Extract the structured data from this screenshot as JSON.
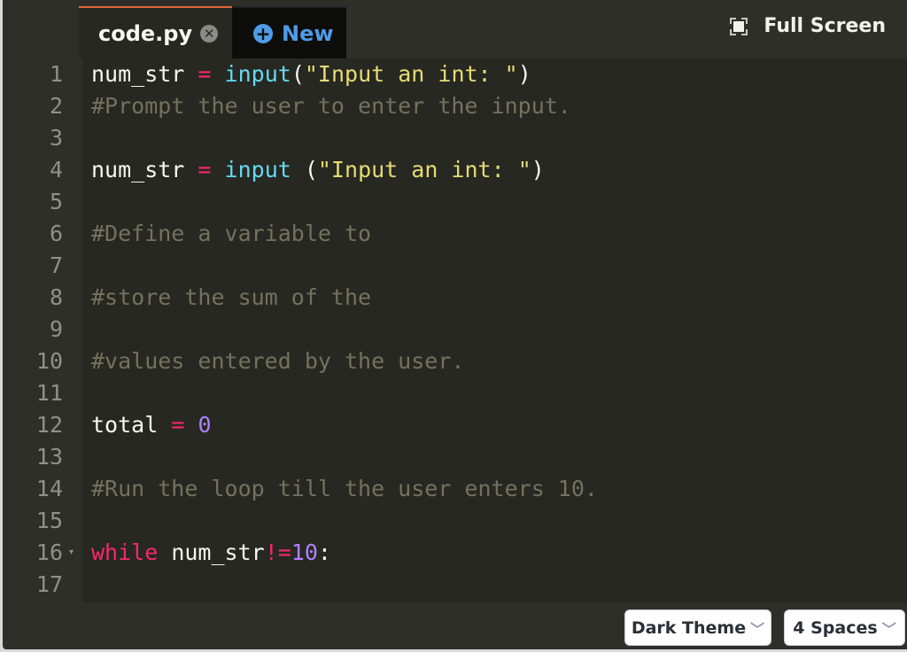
{
  "tabs": [
    {
      "label": "code.py",
      "close_icon": "close-icon",
      "active": true
    },
    {
      "label": "New",
      "icon": "plus-circle-icon",
      "active": false
    }
  ],
  "header": {
    "fullscreen_label": "Full Screen",
    "fullscreen_icon": "fullscreen-icon"
  },
  "editor": {
    "lines": [
      {
        "n": "1",
        "tokens": [
          [
            "",
            "num_str "
          ],
          [
            "op",
            "="
          ],
          [
            "",
            " "
          ],
          [
            "fn",
            "input"
          ],
          [
            "",
            "("
          ],
          [
            "str",
            "\"Input an int: \""
          ],
          [
            "",
            ")"
          ]
        ]
      },
      {
        "n": "2",
        "tokens": [
          [
            "cm",
            "#Prompt the user to enter the input."
          ]
        ]
      },
      {
        "n": "3",
        "tokens": []
      },
      {
        "n": "4",
        "tokens": [
          [
            "",
            "num_str "
          ],
          [
            "op",
            "="
          ],
          [
            "",
            " "
          ],
          [
            "fn",
            "input"
          ],
          [
            "",
            " ("
          ],
          [
            "str",
            "\"Input an int: \""
          ],
          [
            "",
            ")"
          ]
        ]
      },
      {
        "n": "5",
        "tokens": []
      },
      {
        "n": "6",
        "tokens": [
          [
            "cm",
            "#Define a variable to"
          ]
        ]
      },
      {
        "n": "7",
        "tokens": []
      },
      {
        "n": "8",
        "tokens": [
          [
            "cm",
            "#store the sum of the"
          ]
        ]
      },
      {
        "n": "9",
        "tokens": []
      },
      {
        "n": "10",
        "tokens": [
          [
            "cm",
            "#values entered by the user."
          ]
        ]
      },
      {
        "n": "11",
        "tokens": []
      },
      {
        "n": "12",
        "tokens": [
          [
            "",
            "total "
          ],
          [
            "op",
            "="
          ],
          [
            "",
            " "
          ],
          [
            "num",
            "0"
          ]
        ]
      },
      {
        "n": "13",
        "tokens": []
      },
      {
        "n": "14",
        "tokens": [
          [
            "cm",
            "#Run the loop till the user enters 10."
          ]
        ]
      },
      {
        "n": "15",
        "tokens": []
      },
      {
        "n": "16",
        "fold": true,
        "tokens": [
          [
            "kw",
            "while"
          ],
          [
            "",
            " num_str"
          ],
          [
            "op",
            "!="
          ],
          [
            "num",
            "10"
          ],
          [
            "",
            ":"
          ]
        ]
      },
      {
        "n": "17",
        "tokens": []
      }
    ]
  },
  "footer": {
    "theme_select": "Dark Theme",
    "indent_select": "4 Spaces"
  },
  "colors": {
    "accent_tab": "#e0663a",
    "new_tab": "#4f9be8",
    "keyword": "#f92672",
    "function": "#66d9ef",
    "string": "#e6db74",
    "number": "#ae81ff",
    "comment": "#75715e"
  }
}
